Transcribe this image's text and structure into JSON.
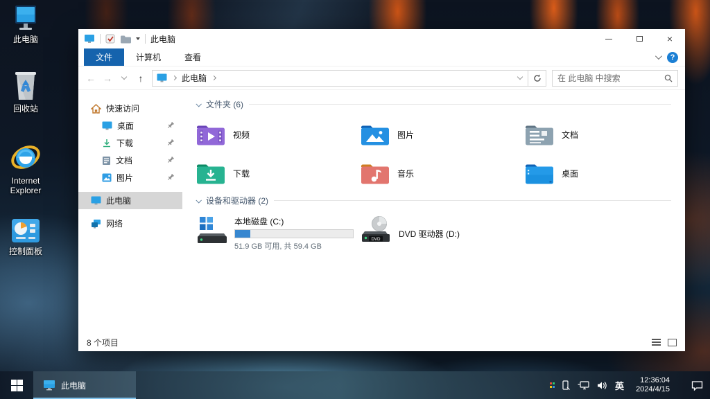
{
  "colors": {
    "ribbon_accent": "#1563ad",
    "taskbar_underline": "#7fc1ea",
    "disk_bar_fill": "#3787d0",
    "sidebar_selected_bg": "#d6d6d6"
  },
  "desktop": {
    "icons": [
      {
        "label": "此电脑"
      },
      {
        "label": "回收站"
      },
      {
        "label": "Internet Explorer"
      },
      {
        "label": "控制面板"
      }
    ]
  },
  "window": {
    "title": "此电脑",
    "tabs": {
      "file": "文件",
      "computer": "计算机",
      "view": "查看"
    },
    "breadcrumb": {
      "location": "此电脑"
    },
    "search_placeholder": "在 此电脑 中搜索",
    "sidebar": {
      "quick_access": "快速访问",
      "pinned_items": [
        {
          "label": "桌面"
        },
        {
          "label": "下载"
        },
        {
          "label": "文档"
        },
        {
          "label": "图片"
        }
      ],
      "this_pc": "此电脑",
      "network": "网络"
    },
    "folders_section": {
      "title": "文件夹 (6)",
      "items": [
        {
          "label": "视频"
        },
        {
          "label": "图片"
        },
        {
          "label": "文档"
        },
        {
          "label": "下载"
        },
        {
          "label": "音乐"
        },
        {
          "label": "桌面"
        }
      ]
    },
    "devices_section": {
      "title": "设备和驱动器 (2)",
      "items": [
        {
          "label": "本地磁盘 (C:)",
          "detail": "51.9 GB 可用, 共 59.4 GB",
          "usage_percent": 13
        },
        {
          "label": "DVD 驱动器 (D:)",
          "badge": "DVD"
        }
      ]
    },
    "statusbar": {
      "items_count": "8 个项目"
    }
  },
  "taskbar": {
    "app": {
      "label": "此电脑"
    },
    "tray": {
      "input_indicator": "英",
      "time": "12:36:04",
      "date": "2024/4/15"
    }
  }
}
